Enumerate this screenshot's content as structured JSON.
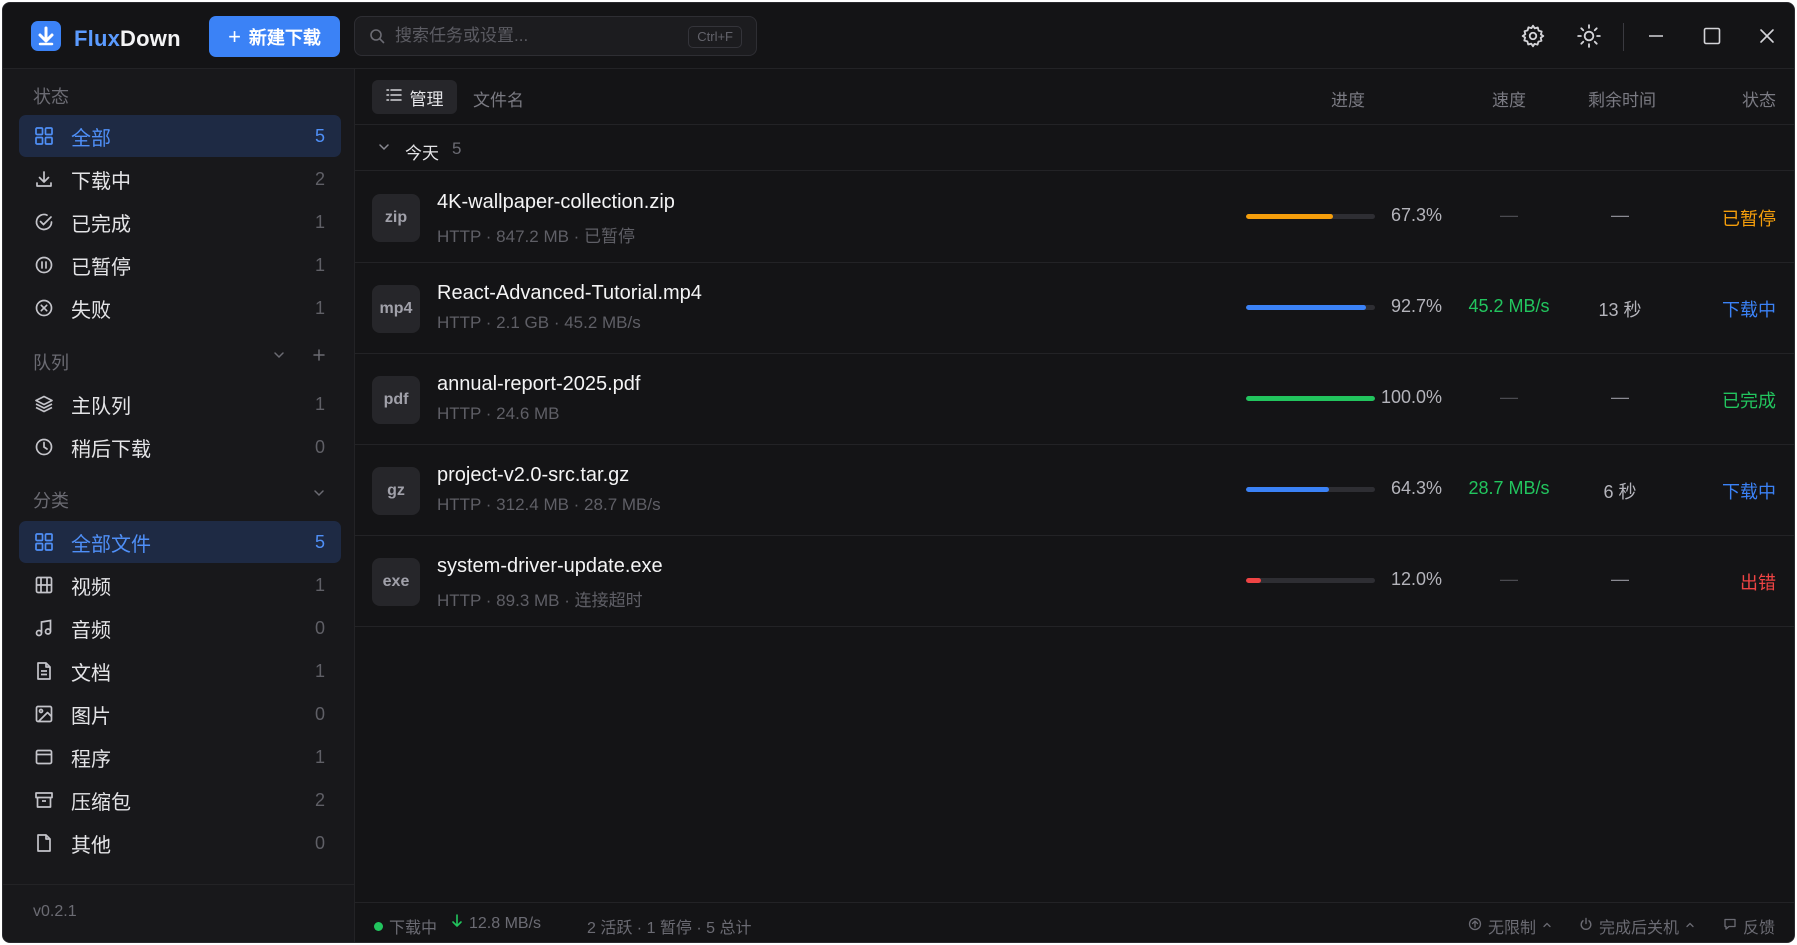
{
  "app": {
    "title_part1": "Flux",
    "title_part2": "Down"
  },
  "toolbar": {
    "new_download_label": "新建下载",
    "search_placeholder": "搜索任务或设置...",
    "search_shortcut": "Ctrl+F"
  },
  "sidebar": {
    "status_header": "状态",
    "status_items": [
      {
        "label": "全部",
        "count": "5",
        "icon": "grid-icon"
      },
      {
        "label": "下载中",
        "count": "2",
        "icon": "download-icon"
      },
      {
        "label": "已完成",
        "count": "1",
        "icon": "check-circle-icon"
      },
      {
        "label": "已暂停",
        "count": "1",
        "icon": "pause-circle-icon"
      },
      {
        "label": "失败",
        "count": "1",
        "icon": "x-circle-icon"
      }
    ],
    "queue_header": "队列",
    "queue_items": [
      {
        "label": "主队列",
        "count": "1",
        "icon": "layers-icon"
      },
      {
        "label": "稍后下载",
        "count": "0",
        "icon": "clock-icon"
      }
    ],
    "category_header": "分类",
    "category_items": [
      {
        "label": "全部文件",
        "count": "5",
        "icon": "grid-icon"
      },
      {
        "label": "视频",
        "count": "1",
        "icon": "film-icon"
      },
      {
        "label": "音频",
        "count": "0",
        "icon": "music-icon"
      },
      {
        "label": "文档",
        "count": "1",
        "icon": "document-icon"
      },
      {
        "label": "图片",
        "count": "0",
        "icon": "image-icon"
      },
      {
        "label": "程序",
        "count": "1",
        "icon": "app-window-icon"
      },
      {
        "label": "压缩包",
        "count": "2",
        "icon": "archive-icon"
      },
      {
        "label": "其他",
        "count": "0",
        "icon": "file-icon"
      }
    ],
    "version": "v0.2.1"
  },
  "columns": {
    "manage": "管理",
    "filename": "文件名",
    "progress": "进度",
    "speed": "速度",
    "remaining": "剩余时间",
    "status": "状态"
  },
  "group": {
    "label": "今天",
    "count": "5"
  },
  "downloads": [
    {
      "ext": "zip",
      "name": "4K-wallpaper-collection.zip",
      "meta": "HTTP · 847.2 MB · 已暂停",
      "progress": 0.673,
      "progress_text": "67.3%",
      "progress_color": "#f59e0b",
      "speed": "—",
      "eta": "—",
      "status": "已暂停",
      "status_color": "#f59e0b"
    },
    {
      "ext": "mp4",
      "name": "React-Advanced-Tutorial.mp4",
      "meta": "HTTP · 2.1 GB · 45.2 MB/s",
      "progress": 0.927,
      "progress_text": "92.7%",
      "progress_color": "#3b82f6",
      "speed": "45.2 MB/s",
      "eta": "13 秒",
      "status": "下载中",
      "status_color": "#3b82f6"
    },
    {
      "ext": "pdf",
      "name": "annual-report-2025.pdf",
      "meta": "HTTP · 24.6 MB",
      "progress": 1.0,
      "progress_text": "100.0%",
      "progress_color": "#22c55e",
      "speed": "—",
      "eta": "—",
      "status": "已完成",
      "status_color": "#22c55e"
    },
    {
      "ext": "gz",
      "name": "project-v2.0-src.tar.gz",
      "meta": "HTTP · 312.4 MB · 28.7 MB/s",
      "progress": 0.643,
      "progress_text": "64.3%",
      "progress_color": "#3b82f6",
      "speed": "28.7 MB/s",
      "eta": "6 秒",
      "status": "下载中",
      "status_color": "#3b82f6"
    },
    {
      "ext": "exe",
      "name": "system-driver-update.exe",
      "meta": "HTTP · 89.3 MB · 连接超时",
      "progress": 0.12,
      "progress_text": "12.0%",
      "progress_color": "#ef4444",
      "speed": "—",
      "eta": "—",
      "status": "出错",
      "status_color": "#ef4444"
    }
  ],
  "statusbar": {
    "state": "下载中",
    "speed": "12.8 MB/s",
    "summary": "2 活跃 · 1 暂停 · 5 总计",
    "limit": "无限制",
    "after_complete": "完成后关机",
    "feedback": "反馈"
  }
}
